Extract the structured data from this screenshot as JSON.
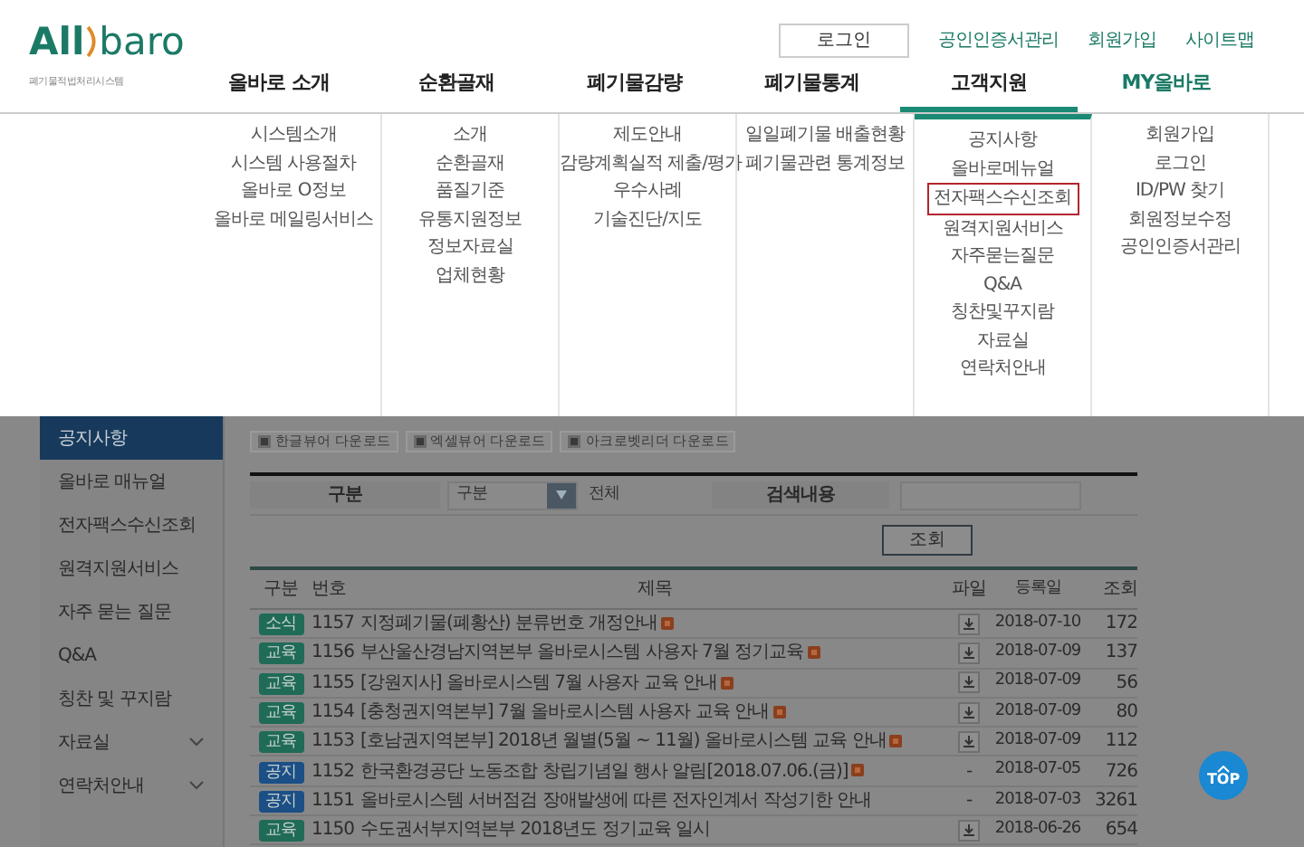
{
  "logo": {
    "parts": [
      "All",
      "baro"
    ],
    "subtitle": "폐기물적법처리시스템"
  },
  "top_links": [
    {
      "label": "로그인",
      "kind": "button"
    },
    {
      "label": "공인인증서관리",
      "kind": "link"
    },
    {
      "label": "회원가입",
      "kind": "link"
    },
    {
      "label": "사이트맵",
      "kind": "link"
    }
  ],
  "nav": [
    {
      "label": "올바로 소개",
      "selected": false,
      "items": [
        {
          "label": "시스템소개",
          "highlighted": false
        },
        {
          "label": "시스템 사용절차",
          "highlighted": false
        },
        {
          "label": "올바로 O정보",
          "highlighted": false
        },
        {
          "label": "올바로 메일링서비스",
          "highlighted": false
        }
      ]
    },
    {
      "label": "순환골재",
      "selected": false,
      "items": [
        {
          "label": "소개",
          "highlighted": false
        },
        {
          "label": "순환골재",
          "highlighted": false
        },
        {
          "label": "품질기준",
          "highlighted": false
        },
        {
          "label": "유통지원정보",
          "highlighted": false
        },
        {
          "label": "정보자료실",
          "highlighted": false
        },
        {
          "label": "업체현황",
          "highlighted": false
        }
      ]
    },
    {
      "label": "폐기물감량",
      "selected": false,
      "items": [
        {
          "label": "제도안내",
          "highlighted": false
        },
        {
          "label": "감량계획실적 제출/평가",
          "highlighted": false
        },
        {
          "label": "우수사례",
          "highlighted": false
        },
        {
          "label": "기술진단/지도",
          "highlighted": false
        }
      ]
    },
    {
      "label": "폐기물통계",
      "selected": false,
      "items": [
        {
          "label": "일일폐기물 배출현황",
          "highlighted": false
        },
        {
          "label": "폐기물관련 통계정보",
          "highlighted": false
        }
      ]
    },
    {
      "label": "고객지원",
      "selected": true,
      "items": [
        {
          "label": "공지사항",
          "highlighted": false
        },
        {
          "label": "올바로메뉴얼",
          "highlighted": false
        },
        {
          "label": "전자팩스수신조회",
          "highlighted": true
        },
        {
          "label": "원격지원서비스",
          "highlighted": false
        },
        {
          "label": "자주묻는질문",
          "highlighted": false
        },
        {
          "label": "Q&A",
          "highlighted": false
        },
        {
          "label": "칭찬및꾸지람",
          "highlighted": false
        },
        {
          "label": "자료실",
          "highlighted": false
        },
        {
          "label": "연락처안내",
          "highlighted": false
        }
      ]
    },
    {
      "label": "MY올바로",
      "selected": false,
      "items": [
        {
          "label": "회원가입",
          "highlighted": false
        },
        {
          "label": "로그인",
          "highlighted": false
        },
        {
          "label": "ID/PW 찾기",
          "highlighted": false
        },
        {
          "label": "회원정보수정",
          "highlighted": false
        },
        {
          "label": "공인인증서관리",
          "highlighted": false
        }
      ]
    }
  ],
  "sidebar": [
    {
      "label": "공지사항",
      "selected": true,
      "expandable": false
    },
    {
      "label": "올바로 매뉴얼",
      "selected": false,
      "expandable": false
    },
    {
      "label": "전자팩스수신조회",
      "selected": false,
      "expandable": false
    },
    {
      "label": "원격지원서비스",
      "selected": false,
      "expandable": false
    },
    {
      "label": "자주 묻는 질문",
      "selected": false,
      "expandable": false
    },
    {
      "label": "Q&A",
      "selected": false,
      "expandable": false
    },
    {
      "label": "칭찬 및 꾸지람",
      "selected": false,
      "expandable": false
    },
    {
      "label": "자료실",
      "selected": false,
      "expandable": true
    },
    {
      "label": "연락처안내",
      "selected": false,
      "expandable": true
    }
  ],
  "downloads": [
    "한글뷰어 다운로드",
    "엑셀뷰어 다운로드",
    "아크로벳리더 다운로드"
  ],
  "search": {
    "category_label": "구분",
    "category_select": "구분",
    "scope_select": "전체",
    "query_label": "검색내용",
    "button": "조회"
  },
  "table": {
    "columns": [
      "구분",
      "번호",
      "제목",
      "파일",
      "등록일",
      "조회"
    ],
    "rows": [
      {
        "tag": "소식",
        "color": "#1f6b57",
        "number": "1157",
        "title": "지정폐기물(폐황산) 분류번호 개정안내",
        "new": true,
        "file": true,
        "date": "2018-07-10",
        "views": "172"
      },
      {
        "tag": "교육",
        "color": "#1f6b57",
        "number": "1156",
        "title": "부산울산경남지역본부 올바로시스템 사용자 7월 정기교육",
        "new": true,
        "file": true,
        "date": "2018-07-09",
        "views": "137"
      },
      {
        "tag": "교육",
        "color": "#1f6b57",
        "number": "1155",
        "title": "[강원지사] 올바로시스템 7월 사용자 교육 안내",
        "new": true,
        "file": true,
        "date": "2018-07-09",
        "views": "56"
      },
      {
        "tag": "교육",
        "color": "#1f6b57",
        "number": "1154",
        "title": "[충청권지역본부] 7월 올바로시스템 사용자 교육 안내",
        "new": true,
        "file": true,
        "date": "2018-07-09",
        "views": "80"
      },
      {
        "tag": "교육",
        "color": "#1f6b57",
        "number": "1153",
        "title": "[호남권지역본부] 2018년 월별(5월 ~ 11월) 올바로시스템 교육 안내",
        "new": true,
        "file": true,
        "date": "2018-07-09",
        "views": "112"
      },
      {
        "tag": "공지",
        "color": "#1b4f86",
        "number": "1152",
        "title": "한국환경공단 노동조합 창립기념일 행사 알림[2018.07.06.(금)]",
        "new": true,
        "file": false,
        "no_file": "-",
        "date": "2018-07-05",
        "views": "726"
      },
      {
        "tag": "공지",
        "color": "#1b4f86",
        "number": "1151",
        "title": "올바로시스템 서버점검 장애발생에 따른 전자인계서 작성기한 안내",
        "new": false,
        "file": false,
        "no_file": "-",
        "date": "2018-07-03",
        "views": "3261"
      },
      {
        "tag": "교육",
        "color": "#1f6b57",
        "number": "1150",
        "title": "수도권서부지역본부 2018년도 정기교육 일시",
        "new": false,
        "file": true,
        "date": "2018-06-26",
        "views": "654"
      }
    ]
  },
  "top_button": "TOP"
}
